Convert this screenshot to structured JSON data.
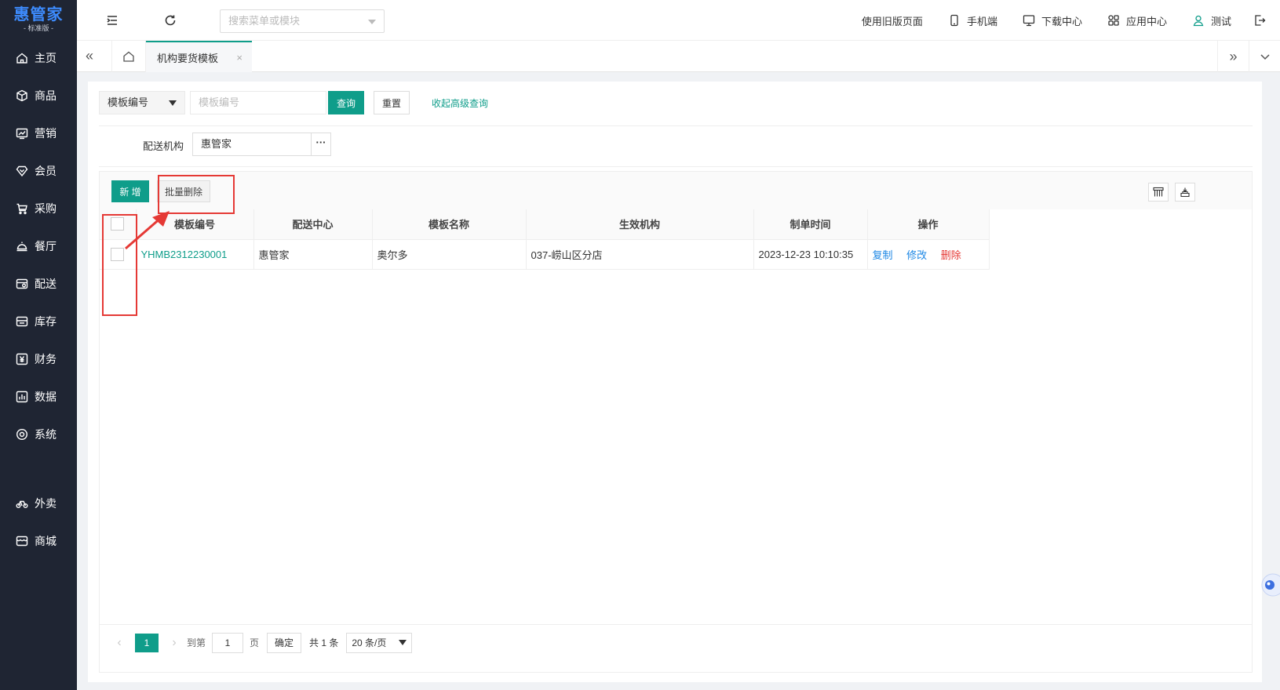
{
  "sidebar": {
    "brand": "惠管家",
    "edition": "- 标准版 -",
    "items": [
      {
        "label": "主页",
        "icon": "home-icon"
      },
      {
        "label": "商品",
        "icon": "box-icon"
      },
      {
        "label": "营销",
        "icon": "trend-chart-icon"
      },
      {
        "label": "会员",
        "icon": "diamond-icon"
      },
      {
        "label": "采购",
        "icon": "cart-icon"
      },
      {
        "label": "餐厅",
        "icon": "cloche-icon"
      },
      {
        "label": "配送",
        "icon": "truck-icon"
      },
      {
        "label": "库存",
        "icon": "inventory-icon"
      },
      {
        "label": "财务",
        "icon": "yuan-icon"
      },
      {
        "label": "数据",
        "icon": "bar-chart-icon"
      },
      {
        "label": "系统",
        "icon": "settings-icon"
      }
    ],
    "extra_items": [
      {
        "label": "外卖",
        "icon": "bike-icon"
      },
      {
        "label": "商城",
        "icon": "store-icon"
      }
    ]
  },
  "topbar": {
    "search_placeholder": "搜索菜单或模块",
    "links": [
      {
        "label": "使用旧版页面"
      },
      {
        "label": "手机端",
        "icon": "phone-icon"
      },
      {
        "label": "下载中心",
        "icon": "monitor-icon"
      },
      {
        "label": "应用中心",
        "icon": "apps-icon"
      },
      {
        "label": "测试",
        "icon": "user-icon"
      }
    ]
  },
  "tabs": {
    "active_label": "机构要货模板",
    "close_glyph": "×"
  },
  "query": {
    "type_label": "模板编号",
    "input_placeholder": "模板编号",
    "search_label": "查询",
    "reset_label": "重置",
    "advanced_label": "收起高级查询",
    "org_label": "配送机构",
    "org_value": "惠管家",
    "org_more": "···"
  },
  "toolbar": {
    "add_label": "新 增",
    "batch_delete_label": "批量删除"
  },
  "table": {
    "columns": [
      "模板编号",
      "配送中心",
      "模板名称",
      "生效机构",
      "制单时间",
      "操作"
    ],
    "rows": [
      {
        "code": "YHMB2312230001",
        "center": "惠管家",
        "name": "奥尔多",
        "org": "037-崂山区分店",
        "time": "2023-12-23 10:10:35",
        "actions": {
          "copy": "复制",
          "edit": "修改",
          "delete": "删除"
        }
      }
    ]
  },
  "pager": {
    "current": "1",
    "goto_label": "到第",
    "goto_value": "1",
    "page_unit": "页",
    "confirm_label": "确定",
    "total_label": "共 1 条",
    "page_size": "20 条/页"
  },
  "colors": {
    "sidebar_bg": "#1f2533",
    "brand": "#3d8bfd",
    "accent": "#0f9d8a",
    "action_blue": "#1e88e5",
    "danger": "#e53935",
    "annotation": "#e53935"
  }
}
